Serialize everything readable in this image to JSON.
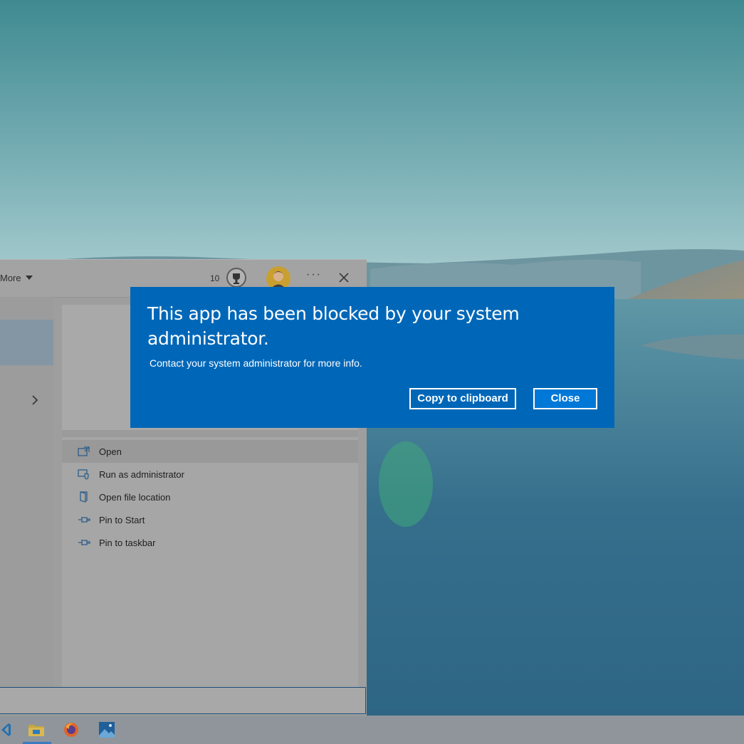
{
  "start_menu": {
    "header": {
      "more_label": "More",
      "points": "10",
      "trophy_icon": "trophy-icon",
      "avatar_icon": "user-avatar-icon",
      "more_options_label": "···",
      "close_icon": "close-icon"
    },
    "nav_chevron_icon": "chevron-right-icon",
    "actions": [
      {
        "label": "Open",
        "icon": "open-icon"
      },
      {
        "label": "Run as administrator",
        "icon": "run-as-admin-icon"
      },
      {
        "label": "Open file location",
        "icon": "file-location-icon"
      },
      {
        "label": "Pin to Start",
        "icon": "pin-icon"
      },
      {
        "label": "Pin to taskbar",
        "icon": "pin-icon"
      }
    ]
  },
  "dialog": {
    "title": "This app has been blocked by your system administrator.",
    "message": "Contact your system administrator for more info.",
    "copy_button": "Copy to clipboard",
    "close_button": "Close",
    "accent_color": "#0067b8"
  },
  "taskbar": {
    "icons": [
      "vscode-icon",
      "file-explorer-icon",
      "firefox-icon",
      "photos-icon"
    ]
  }
}
